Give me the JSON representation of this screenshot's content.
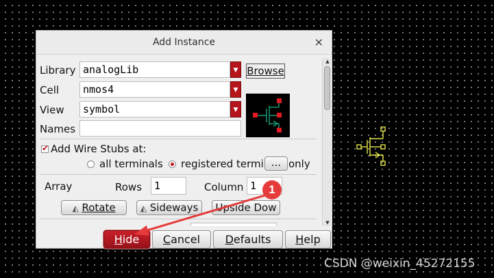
{
  "dialog": {
    "title": "Add Instance",
    "close_glyph": "×",
    "library": {
      "label": "Library",
      "value": "analogLib"
    },
    "cell": {
      "label": "Cell",
      "value": "nmos4"
    },
    "view": {
      "label": "View",
      "value": "symbol"
    },
    "names": {
      "label": "Names",
      "value": ""
    },
    "browse_label": "Browse",
    "wire_stubs": {
      "checkbox_label": "Add Wire Stubs at:",
      "checked": true,
      "option_all": "all terminals",
      "option_registered": "registered termi",
      "option_registered_suffix": "only",
      "more_button": "...",
      "selected": "registered"
    },
    "array": {
      "label": "Array",
      "rows_label": "Rows",
      "rows_value": "1",
      "column_label": "Column",
      "column_value": "1"
    },
    "transform_buttons": {
      "rotate": "Rotate",
      "sideways": "Sideways",
      "upside_down": "Upside Dow"
    },
    "bottom_buttons": {
      "hide_prefix": "H",
      "hide_rest": "ide",
      "cancel_prefix": "C",
      "cancel_rest": "ancel",
      "defaults_prefix": "D",
      "defaults_rest": "efaults",
      "help_prefix": "H",
      "help_rest": "elp"
    }
  },
  "annotation": {
    "badge_number": "1",
    "color": "#e53b3b"
  },
  "canvas": {
    "symbol_color": "#e8e84a"
  },
  "watermark": "CSDN @weixin_45272155",
  "icons": {
    "dropdown": "chevron-down-icon",
    "transform": "triangle-icon"
  }
}
